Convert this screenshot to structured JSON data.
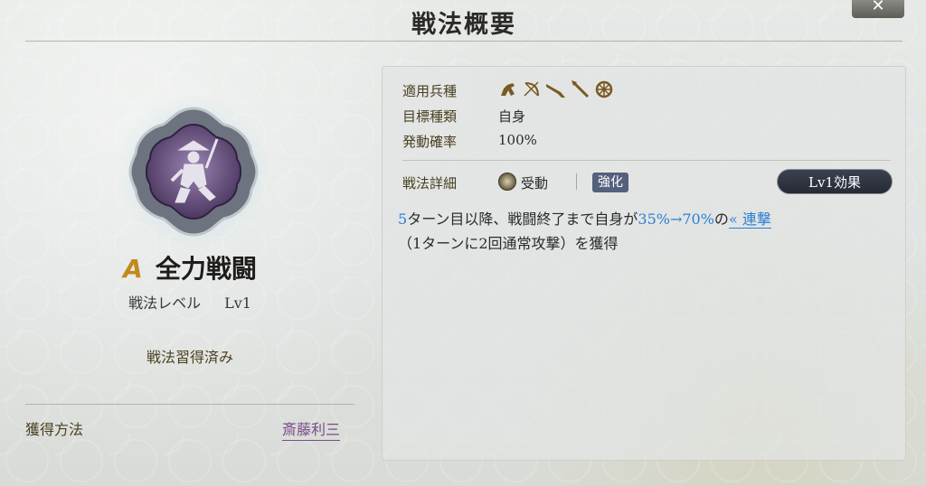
{
  "header": {
    "title": "戦法概要",
    "close_label": "✕"
  },
  "tactic": {
    "rank": "A",
    "name": "全力戦闘",
    "level_label": "戦法レベル",
    "level_value": "Lv1",
    "learned_status": "戦法習得済み",
    "acquisition_label": "獲得方法",
    "acquisition_value": "斎藤利三"
  },
  "details": {
    "unit_label": "適用兵種",
    "unit_icons": [
      "cavalry-icon",
      "bow-icon",
      "gun-icon",
      "spear-icon",
      "siege-wheel-icon"
    ],
    "target_label": "目標種類",
    "target_value": "自身",
    "rate_label": "発動確率",
    "rate_value": "100%",
    "detail_label": "戦法詳細",
    "type_label": "受動",
    "badge": "強化",
    "level_effect_button": "Lv1効果",
    "description": {
      "turn": "5",
      "part1": "ターン目以降、戦闘終了まで自身が",
      "rate_range": "35%→70%",
      "part2": "の",
      "arrow": "«",
      "keyword": "連撃",
      "line2": "（1ターンに2回通常攻撃）を獲得"
    }
  },
  "colors": {
    "rank": "#c08a1e",
    "highlight": "#2b7fd4",
    "link": "#7b4a8a",
    "badge": "#55607d"
  }
}
